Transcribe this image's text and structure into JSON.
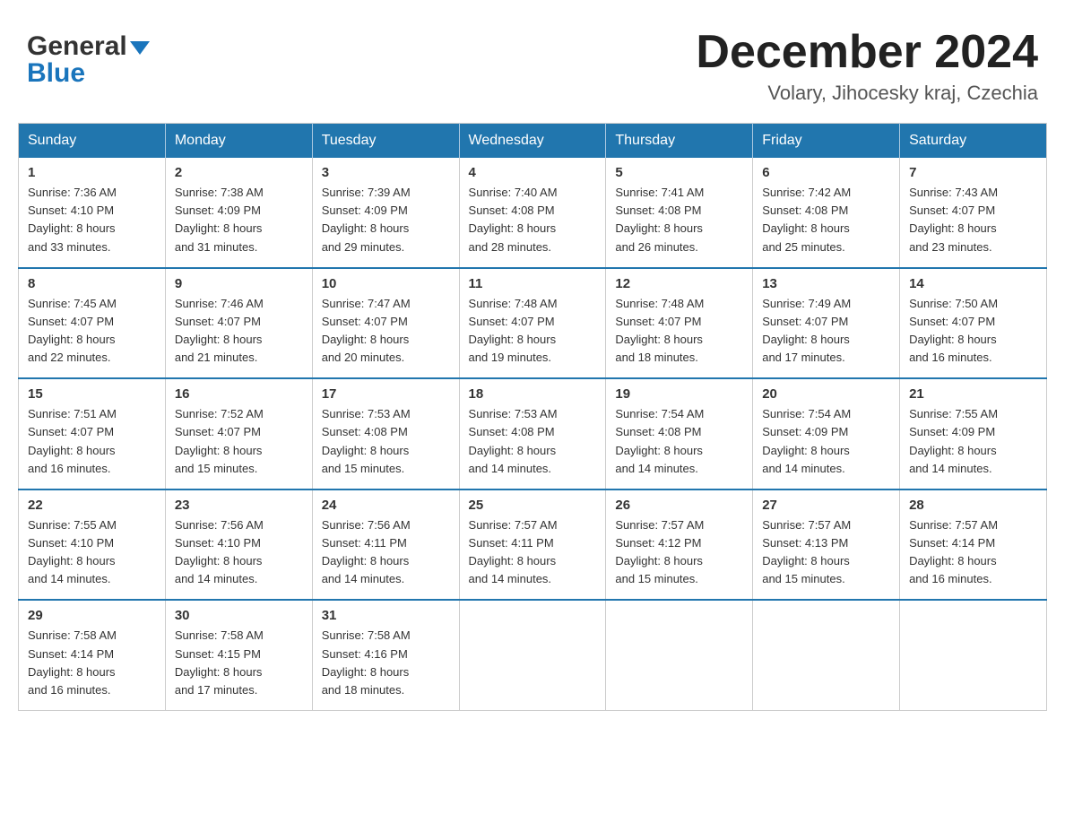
{
  "header": {
    "title": "December 2024",
    "subtitle": "Volary, Jihocesky kraj, Czechia",
    "logo_general": "General",
    "logo_blue": "Blue"
  },
  "weekdays": [
    "Sunday",
    "Monday",
    "Tuesday",
    "Wednesday",
    "Thursday",
    "Friday",
    "Saturday"
  ],
  "weeks": [
    [
      {
        "day": "1",
        "sunrise": "7:36 AM",
        "sunset": "4:10 PM",
        "daylight": "8 hours and 33 minutes."
      },
      {
        "day": "2",
        "sunrise": "7:38 AM",
        "sunset": "4:09 PM",
        "daylight": "8 hours and 31 minutes."
      },
      {
        "day": "3",
        "sunrise": "7:39 AM",
        "sunset": "4:09 PM",
        "daylight": "8 hours and 29 minutes."
      },
      {
        "day": "4",
        "sunrise": "7:40 AM",
        "sunset": "4:08 PM",
        "daylight": "8 hours and 28 minutes."
      },
      {
        "day": "5",
        "sunrise": "7:41 AM",
        "sunset": "4:08 PM",
        "daylight": "8 hours and 26 minutes."
      },
      {
        "day": "6",
        "sunrise": "7:42 AM",
        "sunset": "4:08 PM",
        "daylight": "8 hours and 25 minutes."
      },
      {
        "day": "7",
        "sunrise": "7:43 AM",
        "sunset": "4:07 PM",
        "daylight": "8 hours and 23 minutes."
      }
    ],
    [
      {
        "day": "8",
        "sunrise": "7:45 AM",
        "sunset": "4:07 PM",
        "daylight": "8 hours and 22 minutes."
      },
      {
        "day": "9",
        "sunrise": "7:46 AM",
        "sunset": "4:07 PM",
        "daylight": "8 hours and 21 minutes."
      },
      {
        "day": "10",
        "sunrise": "7:47 AM",
        "sunset": "4:07 PM",
        "daylight": "8 hours and 20 minutes."
      },
      {
        "day": "11",
        "sunrise": "7:48 AM",
        "sunset": "4:07 PM",
        "daylight": "8 hours and 19 minutes."
      },
      {
        "day": "12",
        "sunrise": "7:48 AM",
        "sunset": "4:07 PM",
        "daylight": "8 hours and 18 minutes."
      },
      {
        "day": "13",
        "sunrise": "7:49 AM",
        "sunset": "4:07 PM",
        "daylight": "8 hours and 17 minutes."
      },
      {
        "day": "14",
        "sunrise": "7:50 AM",
        "sunset": "4:07 PM",
        "daylight": "8 hours and 16 minutes."
      }
    ],
    [
      {
        "day": "15",
        "sunrise": "7:51 AM",
        "sunset": "4:07 PM",
        "daylight": "8 hours and 16 minutes."
      },
      {
        "day": "16",
        "sunrise": "7:52 AM",
        "sunset": "4:07 PM",
        "daylight": "8 hours and 15 minutes."
      },
      {
        "day": "17",
        "sunrise": "7:53 AM",
        "sunset": "4:08 PM",
        "daylight": "8 hours and 15 minutes."
      },
      {
        "day": "18",
        "sunrise": "7:53 AM",
        "sunset": "4:08 PM",
        "daylight": "8 hours and 14 minutes."
      },
      {
        "day": "19",
        "sunrise": "7:54 AM",
        "sunset": "4:08 PM",
        "daylight": "8 hours and 14 minutes."
      },
      {
        "day": "20",
        "sunrise": "7:54 AM",
        "sunset": "4:09 PM",
        "daylight": "8 hours and 14 minutes."
      },
      {
        "day": "21",
        "sunrise": "7:55 AM",
        "sunset": "4:09 PM",
        "daylight": "8 hours and 14 minutes."
      }
    ],
    [
      {
        "day": "22",
        "sunrise": "7:55 AM",
        "sunset": "4:10 PM",
        "daylight": "8 hours and 14 minutes."
      },
      {
        "day": "23",
        "sunrise": "7:56 AM",
        "sunset": "4:10 PM",
        "daylight": "8 hours and 14 minutes."
      },
      {
        "day": "24",
        "sunrise": "7:56 AM",
        "sunset": "4:11 PM",
        "daylight": "8 hours and 14 minutes."
      },
      {
        "day": "25",
        "sunrise": "7:57 AM",
        "sunset": "4:11 PM",
        "daylight": "8 hours and 14 minutes."
      },
      {
        "day": "26",
        "sunrise": "7:57 AM",
        "sunset": "4:12 PM",
        "daylight": "8 hours and 15 minutes."
      },
      {
        "day": "27",
        "sunrise": "7:57 AM",
        "sunset": "4:13 PM",
        "daylight": "8 hours and 15 minutes."
      },
      {
        "day": "28",
        "sunrise": "7:57 AM",
        "sunset": "4:14 PM",
        "daylight": "8 hours and 16 minutes."
      }
    ],
    [
      {
        "day": "29",
        "sunrise": "7:58 AM",
        "sunset": "4:14 PM",
        "daylight": "8 hours and 16 minutes."
      },
      {
        "day": "30",
        "sunrise": "7:58 AM",
        "sunset": "4:15 PM",
        "daylight": "8 hours and 17 minutes."
      },
      {
        "day": "31",
        "sunrise": "7:58 AM",
        "sunset": "4:16 PM",
        "daylight": "8 hours and 18 minutes."
      },
      null,
      null,
      null,
      null
    ]
  ],
  "labels": {
    "sunrise": "Sunrise:",
    "sunset": "Sunset:",
    "daylight": "Daylight:"
  },
  "colors": {
    "header_bg": "#2176ae",
    "accent_blue": "#1a75bc"
  }
}
